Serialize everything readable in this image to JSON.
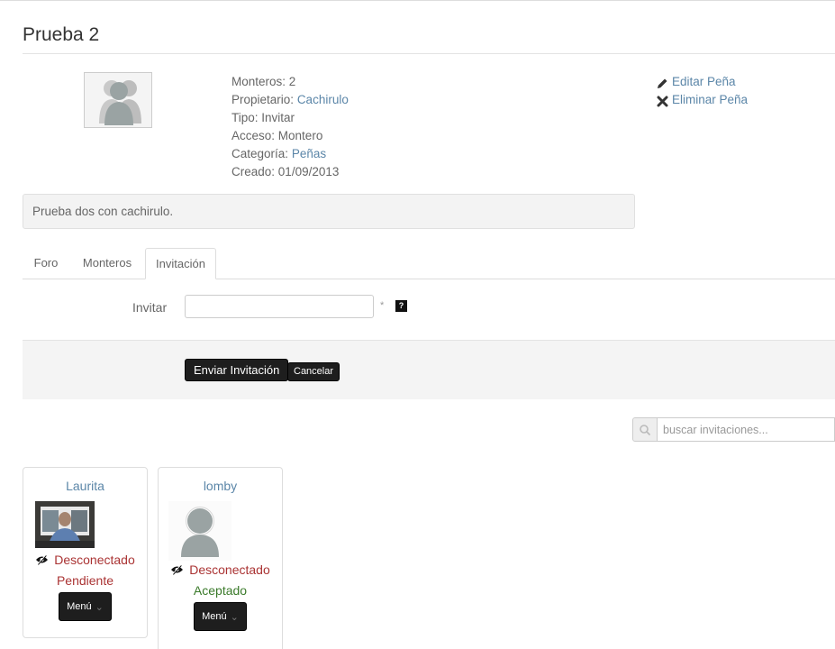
{
  "page": {
    "title": "Prueba 2"
  },
  "info": {
    "monteros_label": "Monteros:",
    "monteros_value": "2",
    "propietario_label": "Propietario:",
    "propietario_value": "Cachirulo",
    "tipo_label": "Tipo:",
    "tipo_value": "Invitar",
    "acceso_label": "Acceso:",
    "acceso_value": "Montero",
    "categoria_label": "Categoría:",
    "categoria_value": "Peñas",
    "creado_label": "Creado:",
    "creado_value": "01/09/2013"
  },
  "actions": {
    "edit_label": "Editar Peña",
    "delete_label": "Eliminar Peña"
  },
  "description": "Prueba dos con cachirulo.",
  "tabs": [
    {
      "label": "Foro"
    },
    {
      "label": "Monteros"
    },
    {
      "label": "Invitación",
      "active": true
    }
  ],
  "invite_form": {
    "label": "Invitar",
    "value": "",
    "required_mark": "*",
    "help_mark": "?",
    "submit_label": "Enviar Invitación",
    "cancel_label": "Cancelar"
  },
  "search": {
    "placeholder": "buscar invitaciones..."
  },
  "invitations": [
    {
      "user": "Laurita",
      "connection": "Desconectado",
      "state": "Pendiente",
      "menu_label": "Menú"
    },
    {
      "user": "lomby",
      "connection": "Desconectado",
      "state": "Aceptado",
      "menu_label": "Menú"
    }
  ],
  "colors": {
    "link": "#5b86a8",
    "offline": "#aa3333",
    "accepted": "#3a7a2a",
    "button": "#1e1e1e"
  }
}
